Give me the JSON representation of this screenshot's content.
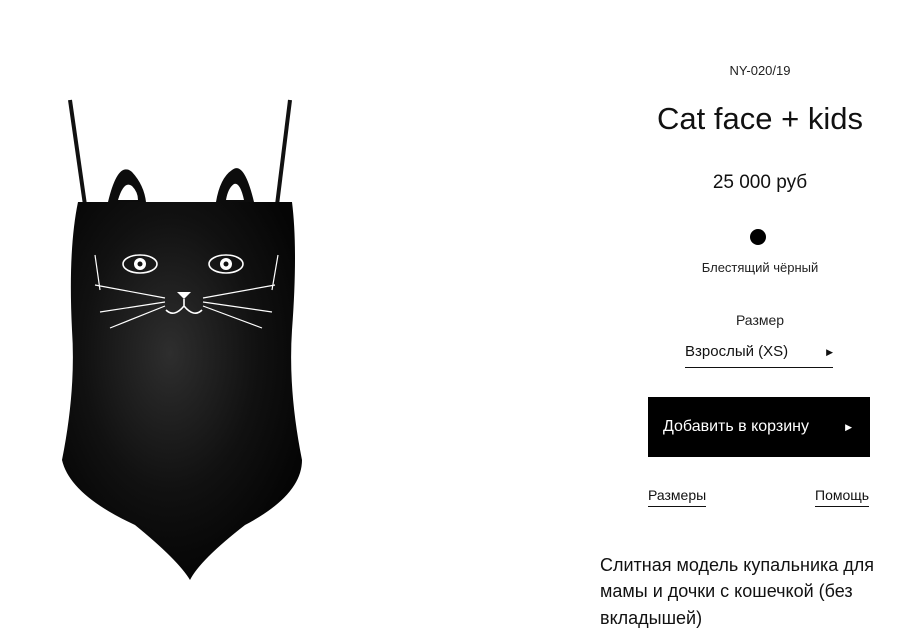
{
  "product": {
    "sku": "NY-020/19",
    "title": "Cat face + kids",
    "price": "25 000 руб",
    "color": {
      "name": "Блестящий чёрный",
      "swatch": "#000000"
    },
    "size": {
      "label": "Размер",
      "selected": "Взрослый (XS)"
    },
    "add_to_cart_label": "Добавить в корзину",
    "links": {
      "sizes": "Размеры",
      "help": "Помощь"
    },
    "description": "Слитная модель купальника для мамы и дочки с кошечкой (без вкладышей)"
  },
  "icons": {
    "size_arrow": "caret-right-icon",
    "cart_arrow": "caret-right-icon",
    "swatch": "color-swatch"
  }
}
